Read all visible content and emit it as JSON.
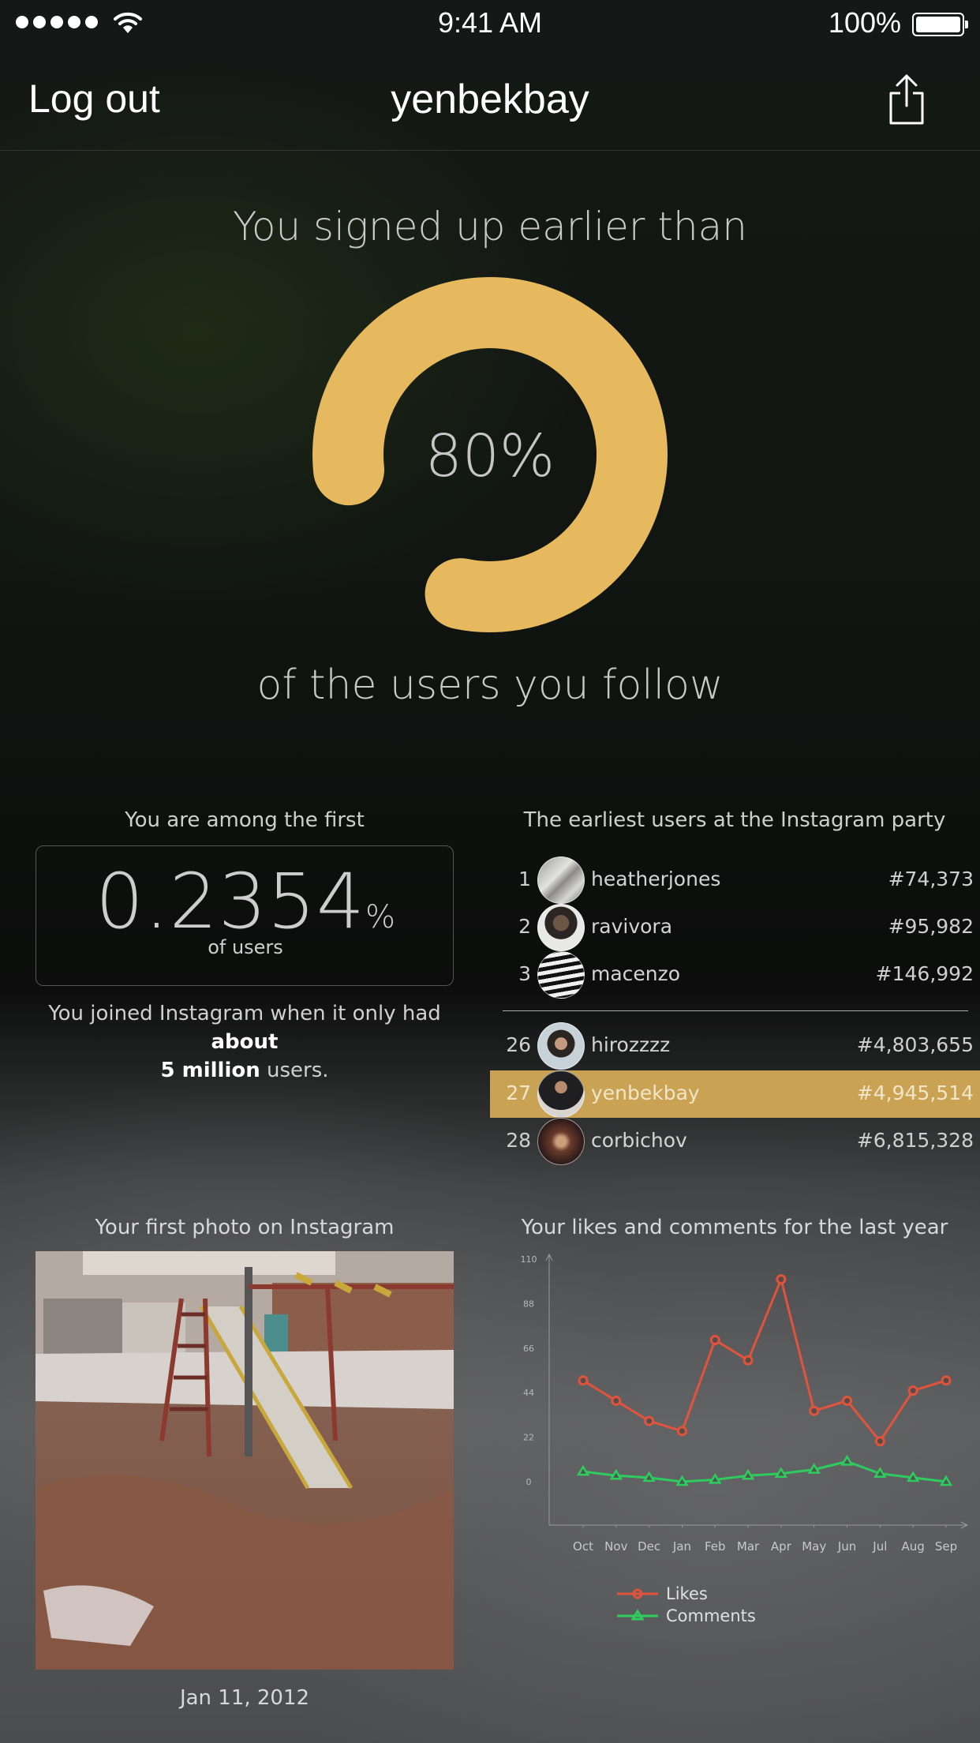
{
  "status_bar": {
    "time": "9:41 AM",
    "battery": "100%",
    "icons": [
      "signal-dots-icon",
      "wifi-icon",
      "battery-icon"
    ]
  },
  "nav": {
    "left_action": "Log out",
    "title": "yenbekbay",
    "right_icon": "share-icon"
  },
  "signup": {
    "heading": "You signed up earlier than",
    "percent_label": "80%",
    "percent_value": 80,
    "footer": "of the users you follow",
    "ring_color": "#e6b95e"
  },
  "among": {
    "title": "You are among the first",
    "value": "0.2354",
    "unit": "%",
    "subtitle": "of users",
    "joined_text_1": "You joined Instagram when it only had ",
    "joined_bold_1": "about",
    "joined_bold_2": "5 million",
    "joined_text_2": " users."
  },
  "earliest": {
    "title": "The earliest users at the Instagram party",
    "top": [
      {
        "rank": "1",
        "name": "heatherjones",
        "number": "#74,373"
      },
      {
        "rank": "2",
        "name": "ravivora",
        "number": "#95,982"
      },
      {
        "rank": "3",
        "name": "macenzo",
        "number": "#146,992"
      }
    ],
    "around": [
      {
        "rank": "26",
        "name": "hirozzzz",
        "number": "#4,803,655"
      },
      {
        "rank": "27",
        "name": "yenbekbay",
        "number": "#4,945,514",
        "highlight": true
      },
      {
        "rank": "28",
        "name": "corbichov",
        "number": "#6,815,328"
      }
    ],
    "highlight_color": "#c9a254"
  },
  "first_photo": {
    "title": "Your first photo on Instagram",
    "date": "Jan 11, 2012"
  },
  "chart_data": {
    "type": "line",
    "title": "Your likes and comments for the last year",
    "categories": [
      "Oct",
      "Nov",
      "Dec",
      "Jan",
      "Feb",
      "Mar",
      "Apr",
      "May",
      "Jun",
      "Jul",
      "Aug",
      "Sep"
    ],
    "series": [
      {
        "name": "Likes",
        "color": "#e0533d",
        "marker": "circle",
        "values": [
          50,
          40,
          30,
          25,
          70,
          60,
          100,
          35,
          40,
          20,
          45,
          50
        ]
      },
      {
        "name": "Comments",
        "color": "#2ecc5f",
        "marker": "triangle",
        "values": [
          5,
          3,
          2,
          0,
          1,
          3,
          4,
          6,
          10,
          4,
          2,
          0
        ]
      }
    ],
    "y_ticks": [
      "110",
      "88",
      "66",
      "44",
      "22",
      "0"
    ],
    "ylim": [
      0,
      110
    ],
    "grid": false,
    "legend_position": "bottom-left"
  }
}
